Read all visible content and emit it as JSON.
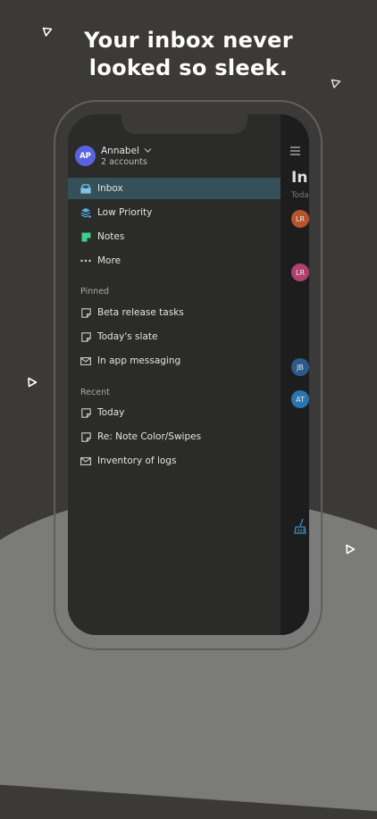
{
  "headline": {
    "line1": "Your inbox never",
    "line2": "looked so sleek."
  },
  "account": {
    "initials": "AP",
    "name": "Annabel",
    "subtitle": "2 accounts",
    "avatar_color": "#5a62df"
  },
  "nav": [
    {
      "label": "Inbox",
      "icon": "inbox-icon",
      "selected": true,
      "color": "#7fc3e6"
    },
    {
      "label": "Low Priority",
      "icon": "layers-icon",
      "color": "#4fb1e0"
    },
    {
      "label": "Notes",
      "icon": "note-icon",
      "color": "#3ecf8e"
    },
    {
      "label": "More",
      "icon": "more-icon",
      "color": "#cfcfcf"
    }
  ],
  "pinned": {
    "header": "Pinned",
    "items": [
      {
        "label": "Beta release tasks",
        "icon": "note-outline-icon"
      },
      {
        "label": "Today's slate",
        "icon": "note-outline-icon"
      },
      {
        "label": "In app messaging",
        "icon": "mail-icon"
      }
    ]
  },
  "recent": {
    "header": "Recent",
    "items": [
      {
        "label": "Today",
        "icon": "note-outline-icon"
      },
      {
        "label": "Re: Note Color/Swipes",
        "icon": "note-outline-icon"
      },
      {
        "label": "Inventory of logs",
        "icon": "mail-icon"
      }
    ]
  },
  "peek": {
    "title": "In",
    "subtitle": "Toda",
    "avatars": [
      {
        "initials": "LR",
        "color": "#b5552e"
      },
      {
        "initials": "LR",
        "color": "#b2406e"
      },
      {
        "initials": "JB",
        "color": "#2c5a8a"
      },
      {
        "initials": "AT",
        "color": "#2a76b0"
      }
    ]
  },
  "colors": {
    "background": "#3b3a38",
    "selected_row": "#355058",
    "drawer": "#2b2b2a"
  }
}
